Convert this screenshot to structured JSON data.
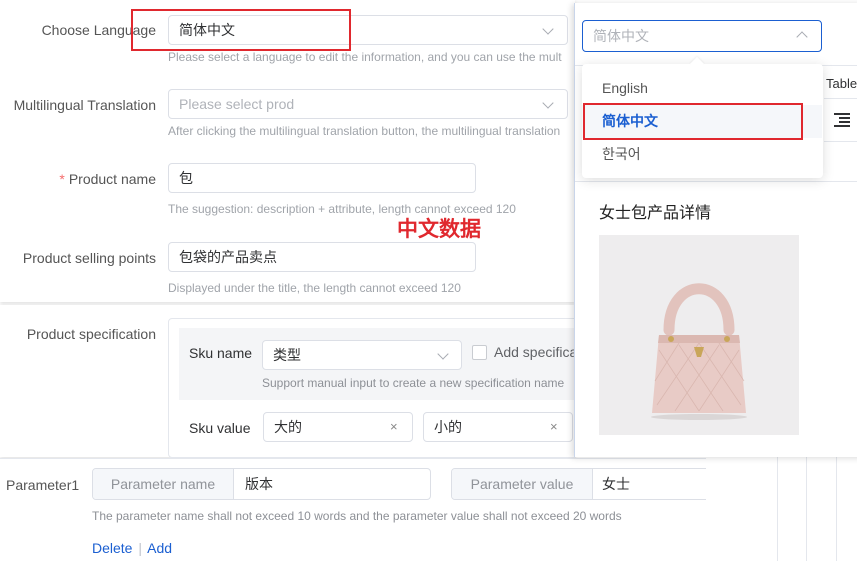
{
  "form": {
    "choose_language": {
      "label": "Choose Language",
      "value": "简体中文",
      "hint": "Please select a language to edit the information, and you can use the mult"
    },
    "multilingual_translation": {
      "label": "Multilingual Translation",
      "placeholder": "Please select prod",
      "hint": "After clicking the multilingual translation button, the multilingual translation"
    },
    "product_name": {
      "required_mark": "*",
      "label": "Product name",
      "value": "包",
      "hint": "The suggestion: description + attribute, length cannot exceed 120"
    },
    "selling_points": {
      "label": "Product selling points",
      "value": "包袋的产品卖点",
      "hint": "Displayed under the title, the length cannot exceed 120"
    }
  },
  "annotation": {
    "text": "中文数据",
    "color": "#e0282e"
  },
  "specification": {
    "label": "Product specification",
    "sku_name_label": "Sku name",
    "sku_name_value": "类型",
    "add_spec_label": "Add specifica",
    "sku_name_hint": "Support manual input to create a new specification name",
    "sku_value_label": "Sku value",
    "sku_values": [
      "大的",
      "小的"
    ],
    "remove_symbol": "×"
  },
  "parameter": {
    "label": "Parameter1",
    "name_addon": "Parameter name",
    "name_value": "版本",
    "value_addon": "Parameter value",
    "value_value": "女士",
    "hint": "The parameter name shall not exceed 10 words and the parameter value shall not exceed 20 words",
    "delete_label": "Delete",
    "separator": "|",
    "add_label": "Add"
  },
  "language_dropdown": {
    "selected": "简体中文",
    "options": [
      {
        "label": "English",
        "selected": false
      },
      {
        "label": "简体中文",
        "selected": true
      },
      {
        "label": "한국어",
        "selected": false
      }
    ]
  },
  "preview": {
    "table_tab": "Table",
    "title": "女士包产品详情",
    "image_alt": "pink quilted handbag"
  },
  "colors": {
    "accent": "#1b5fd1",
    "highlight_border": "#e0282e",
    "selected_option": "#1b5fd1"
  }
}
